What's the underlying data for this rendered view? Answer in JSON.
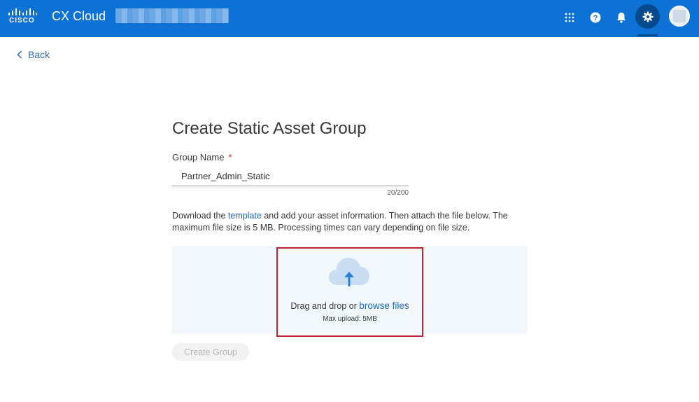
{
  "header": {
    "logo_text": "CISCO",
    "app_title": "CX Cloud",
    "icons": [
      "apps-grid-icon",
      "help-icon",
      "bell-icon",
      "gear-icon",
      "avatar"
    ]
  },
  "nav": {
    "back_label": "Back"
  },
  "form": {
    "title": "Create Static Asset Group",
    "group_name_label": "Group Name",
    "required_mark": "*",
    "group_name_value": "Partner_Admin_Static",
    "char_counter": "20/200",
    "instructions_before": "Download the ",
    "template_link": "template",
    "instructions_after": " and add your asset information. Then attach the file below. The maximum file size is 5 MB. Processing times can vary depending on file size.",
    "drop_text": "Drag and drop or ",
    "browse_link": "browse files",
    "max_upload": "Max upload: 5MB",
    "create_button": "Create Group"
  },
  "colors": {
    "header_bg": "#0d72d6",
    "link": "#1d69cc",
    "highlight": "#c0222f",
    "dropzone_bg": "#f2f7fc"
  }
}
